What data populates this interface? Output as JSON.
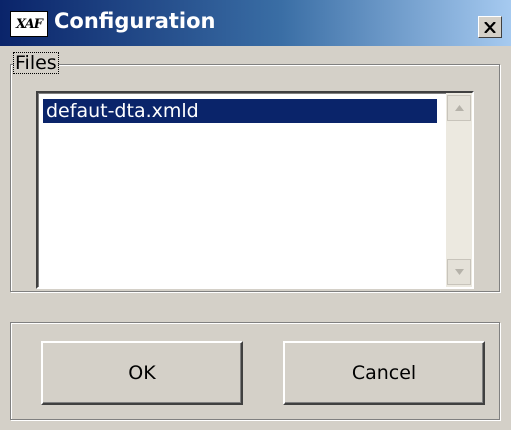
{
  "window": {
    "title": "Configuration",
    "logo_text": "XAF",
    "close_icon": "close-icon"
  },
  "files_group": {
    "label": "Files",
    "items": [
      {
        "label": "defaut-dta.xmld",
        "selected": true
      }
    ]
  },
  "buttons": {
    "ok_label": "OK",
    "cancel_label": "Cancel"
  },
  "colors": {
    "selection": "#0a246a",
    "title_gradient_start": "#0a246a",
    "title_gradient_end": "#a6caf0",
    "face": "#d4d0c8"
  }
}
